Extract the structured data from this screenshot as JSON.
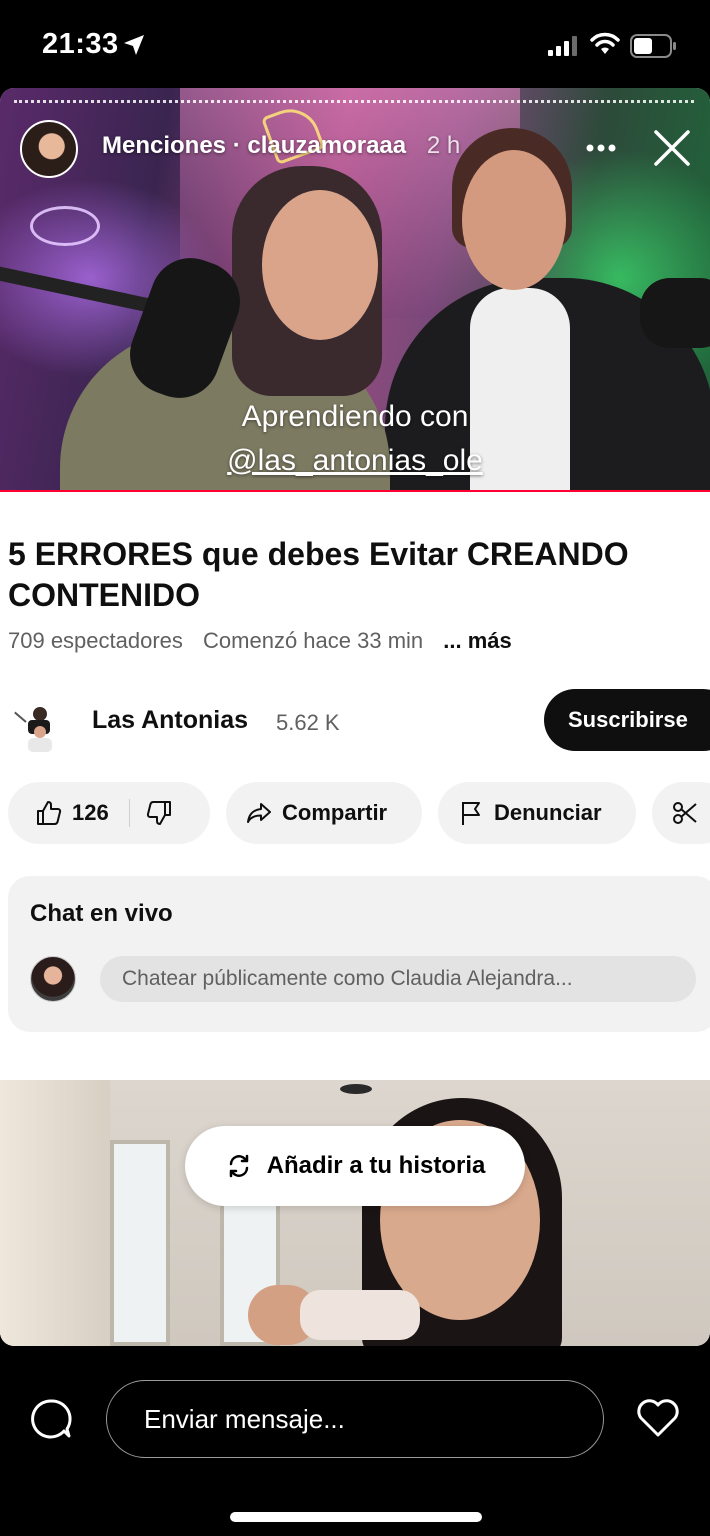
{
  "status_bar": {
    "time": "21:33"
  },
  "story": {
    "header_source": "Menciones",
    "header_separator": "·",
    "header_user": "clauzamoraaa",
    "header_time": "2 h",
    "caption_line1": "Aprendiendo con",
    "caption_line2": "@las_antonias_ole",
    "add_to_story_label": "Añadir a tu historia"
  },
  "youtube": {
    "title": "5 ERRORES que debes Evitar CREANDO CONTENIDO",
    "viewers": "709 espectadores",
    "started": "Comenzó hace 33 min",
    "more_label": "... más",
    "channel_name": "Las Antonias",
    "subscribers": "5.62 K",
    "subscribe_label": "Suscribirse",
    "like_count": "126",
    "share_label": "Compartir",
    "report_label": "Denunciar",
    "live_chat_title": "Chat en vivo",
    "chat_placeholder": "Chatear públicamente como Claudia Alejandra..."
  },
  "bottom_bar": {
    "message_placeholder": "Enviar mensaje..."
  },
  "colors": {
    "youtube_red": "#ff0033",
    "pill_bg": "#f2f2f2",
    "subscribe_bg": "#0f0f0f"
  },
  "icons": [
    "location-arrow-icon",
    "signal-icon",
    "wifi-icon",
    "battery-icon",
    "more-icon",
    "close-icon",
    "thumbs-up-icon",
    "thumbs-down-icon",
    "share-icon",
    "flag-icon",
    "scissors-icon",
    "repost-icon",
    "chat-bubble-icon",
    "heart-icon"
  ]
}
